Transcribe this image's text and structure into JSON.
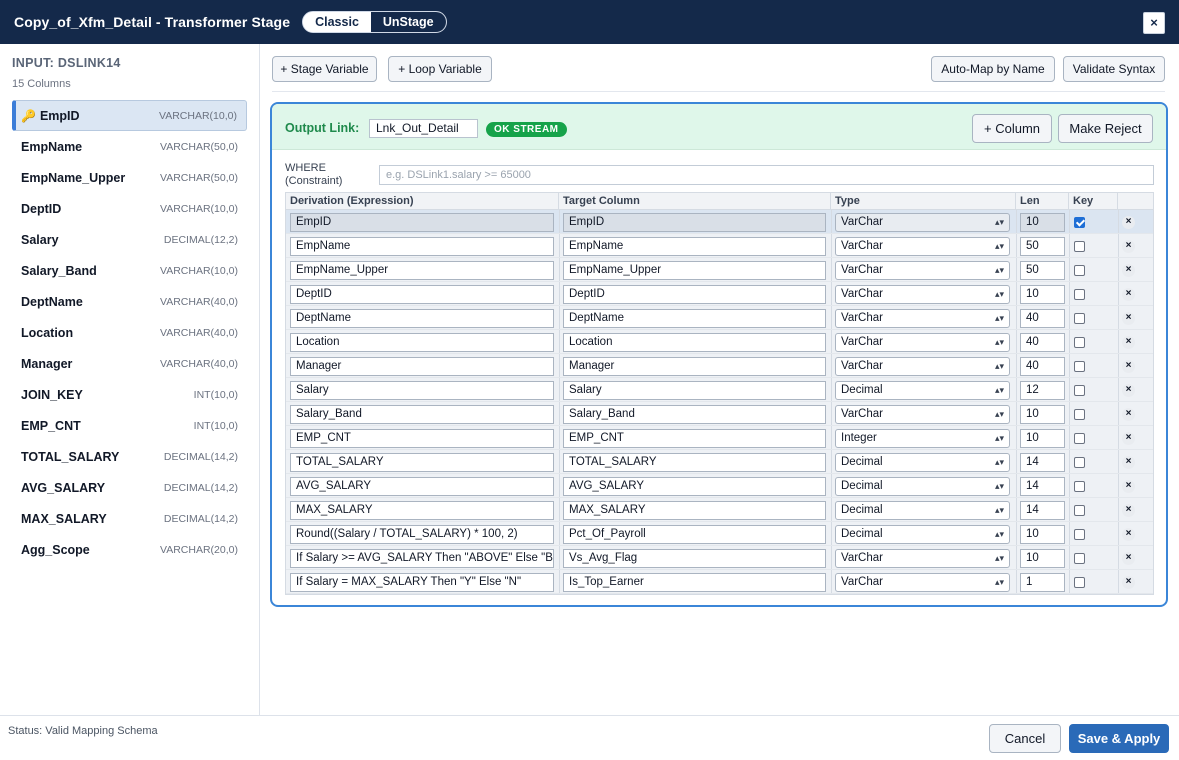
{
  "window": {
    "title": "Copy_of_Xfm_Detail - Transformer Stage",
    "modes": [
      "Classic",
      "UnStage"
    ],
    "active_mode": "Classic",
    "close_label": "×"
  },
  "sidebar": {
    "input_title": "INPUT: DSLINK14",
    "column_count": "15 Columns",
    "key_symbol": "🔑",
    "columns": [
      {
        "name": "EmpID",
        "type": "VARCHAR(10,0)",
        "key": true
      },
      {
        "name": "EmpName",
        "type": "VARCHAR(50,0)"
      },
      {
        "name": "EmpName_Upper",
        "type": "VARCHAR(50,0)"
      },
      {
        "name": "DeptID",
        "type": "VARCHAR(10,0)"
      },
      {
        "name": "Salary",
        "type": "DECIMAL(12,2)"
      },
      {
        "name": "Salary_Band",
        "type": "VARCHAR(10,0)"
      },
      {
        "name": "DeptName",
        "type": "VARCHAR(40,0)"
      },
      {
        "name": "Location",
        "type": "VARCHAR(40,0)"
      },
      {
        "name": "Manager",
        "type": "VARCHAR(40,0)"
      },
      {
        "name": "JOIN_KEY",
        "type": "INT(10,0)"
      },
      {
        "name": "EMP_CNT",
        "type": "INT(10,0)"
      },
      {
        "name": "TOTAL_SALARY",
        "type": "DECIMAL(14,2)"
      },
      {
        "name": "AVG_SALARY",
        "type": "DECIMAL(14,2)"
      },
      {
        "name": "MAX_SALARY",
        "type": "DECIMAL(14,2)"
      },
      {
        "name": "Agg_Scope",
        "type": "VARCHAR(20,0)"
      }
    ]
  },
  "toolbar": {
    "stage_variable": "+ Stage Variable",
    "loop_variable": "+ Loop Variable",
    "auto_map": "Auto-Map by Name",
    "validate": "Validate Syntax"
  },
  "output": {
    "label": "Output Link:",
    "link_name": "Lnk_Out_Detail",
    "badge": "OK STREAM",
    "add_column": "+ Column",
    "make_reject": "Make Reject",
    "where_label_1": "WHERE",
    "where_label_2": "(Constraint)",
    "where_placeholder": "e.g. DSLink1.salary >= 65000"
  },
  "grid": {
    "headers": {
      "derivation": "Derivation (Expression)",
      "target": "Target Column",
      "type": "Type",
      "len": "Len",
      "key": "Key"
    },
    "chevron": "⌃⌄",
    "delete_label": "×",
    "rows": [
      {
        "derivation": "EmpID",
        "target": "EmpID",
        "type": "VarChar",
        "len": "10",
        "key": true
      },
      {
        "derivation": "EmpName",
        "target": "EmpName",
        "type": "VarChar",
        "len": "50",
        "key": false
      },
      {
        "derivation": "EmpName_Upper",
        "target": "EmpName_Upper",
        "type": "VarChar",
        "len": "50",
        "key": false
      },
      {
        "derivation": "DeptID",
        "target": "DeptID",
        "type": "VarChar",
        "len": "10",
        "key": false
      },
      {
        "derivation": "DeptName",
        "target": "DeptName",
        "type": "VarChar",
        "len": "40",
        "key": false
      },
      {
        "derivation": "Location",
        "target": "Location",
        "type": "VarChar",
        "len": "40",
        "key": false
      },
      {
        "derivation": "Manager",
        "target": "Manager",
        "type": "VarChar",
        "len": "40",
        "key": false
      },
      {
        "derivation": "Salary",
        "target": "Salary",
        "type": "Decimal",
        "len": "12",
        "key": false
      },
      {
        "derivation": "Salary_Band",
        "target": "Salary_Band",
        "type": "VarChar",
        "len": "10",
        "key": false
      },
      {
        "derivation": "EMP_CNT",
        "target": "EMP_CNT",
        "type": "Integer",
        "len": "10",
        "key": false
      },
      {
        "derivation": "TOTAL_SALARY",
        "target": "TOTAL_SALARY",
        "type": "Decimal",
        "len": "14",
        "key": false
      },
      {
        "derivation": "AVG_SALARY",
        "target": "AVG_SALARY",
        "type": "Decimal",
        "len": "14",
        "key": false
      },
      {
        "derivation": "MAX_SALARY",
        "target": "MAX_SALARY",
        "type": "Decimal",
        "len": "14",
        "key": false
      },
      {
        "derivation": "Round((Salary / TOTAL_SALARY) * 100, 2)",
        "target": "Pct_Of_Payroll",
        "type": "Decimal",
        "len": "10",
        "key": false
      },
      {
        "derivation": "If Salary >= AVG_SALARY Then \"ABOVE\" Else \"B",
        "target": "Vs_Avg_Flag",
        "type": "VarChar",
        "len": "10",
        "key": false
      },
      {
        "derivation": "If Salary = MAX_SALARY Then \"Y\" Else \"N\"",
        "target": "Is_Top_Earner",
        "type": "VarChar",
        "len": "1",
        "key": false
      }
    ]
  },
  "footer": {
    "status": "Status: Valid Mapping Schema",
    "cancel": "Cancel",
    "apply": "Save & Apply"
  }
}
